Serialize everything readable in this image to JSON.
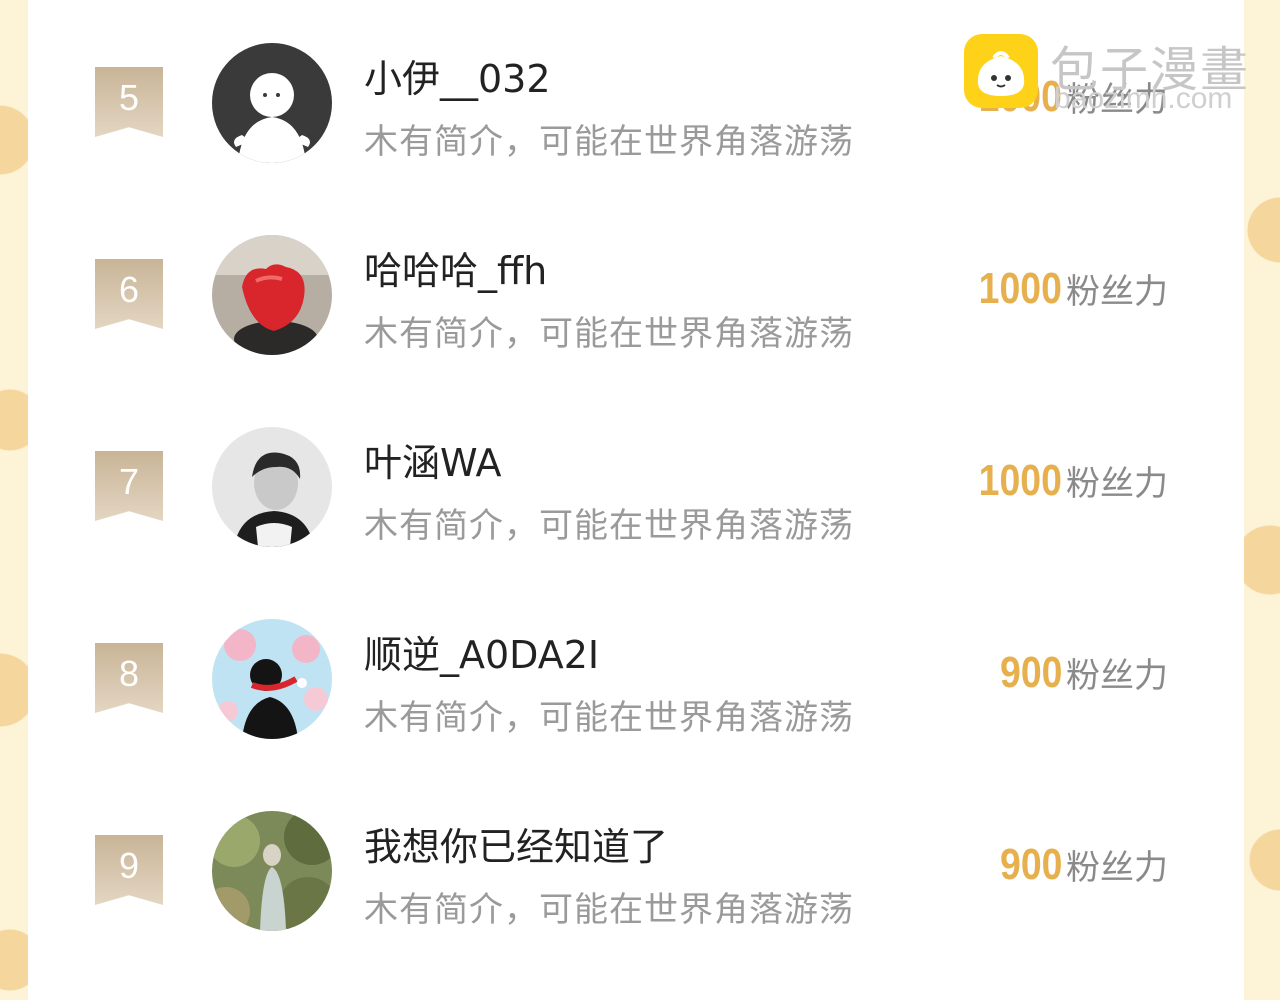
{
  "unit_label": "粉丝力",
  "users": [
    {
      "rank": "5",
      "name": "小伊__032",
      "bio": "木有简介，可能在世界角落游荡",
      "fans": "1000",
      "avatar": "default-ghost-avatar"
    },
    {
      "rank": "6",
      "name": "哈哈哈_ffh",
      "bio": "木有简介，可能在世界角落游荡",
      "fans": "1000",
      "avatar": "red-fruit-photo-avatar"
    },
    {
      "rank": "7",
      "name": "叶涵WA",
      "bio": "木有简介，可能在世界角落游荡",
      "fans": "1000",
      "avatar": "grayscale-portrait-avatar"
    },
    {
      "rank": "8",
      "name": "顺逆_A0DA2I",
      "bio": "木有简介，可能在世界角落游荡",
      "fans": "900",
      "avatar": "anime-illustration-avatar"
    },
    {
      "rank": "9",
      "name": "我想你已经知道了",
      "bio": "木有简介，可能在世界角落游荡",
      "fans": "900",
      "avatar": "forest-figure-photo-avatar"
    }
  ],
  "watermark": {
    "title": "包子漫畫",
    "url": "baozimh.com"
  },
  "colors": {
    "page_background": "#fdf3d6",
    "rank_badge": "#c9b497",
    "fans_number": "#e7b04e",
    "bio_text": "#9a9a9a",
    "name_text": "#222222",
    "logo_yellow": "#ffd21a"
  }
}
